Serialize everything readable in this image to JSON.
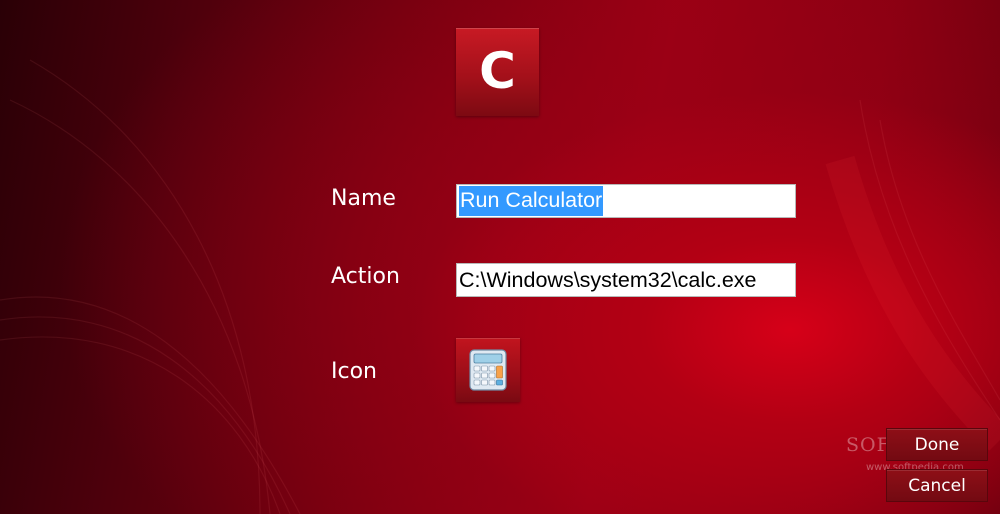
{
  "tile": {
    "letter": "C",
    "icon": "letter-c-tile"
  },
  "form": {
    "name_label": "Name",
    "name_value": "Run Calculator",
    "action_label": "Action",
    "action_value": "C:\\Windows\\system32\\calc.exe",
    "icon_label": "Icon",
    "icon_image": "calculator-icon"
  },
  "buttons": {
    "done": "Done",
    "cancel": "Cancel"
  },
  "watermark": {
    "brand": "SOFTPEDIA",
    "url": "www.softpedia.com"
  },
  "colors": {
    "background": "#8a0012",
    "tile": "#a4101a",
    "selection": "#3399ff"
  }
}
